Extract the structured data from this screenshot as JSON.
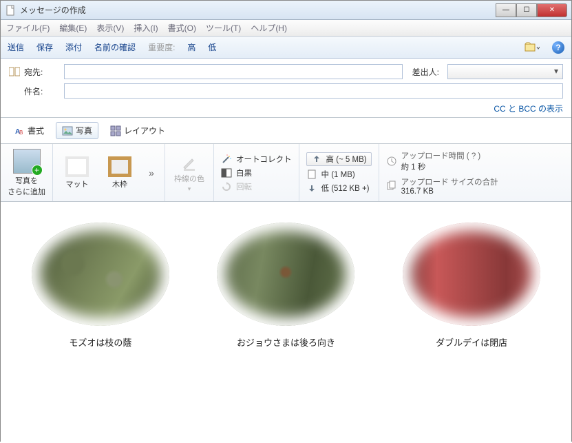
{
  "window": {
    "title": "メッセージの作成"
  },
  "menubar": {
    "file": "ファイル(F)",
    "edit": "編集(E)",
    "view": "表示(V)",
    "insert": "挿入(I)",
    "format": "書式(O)",
    "tools": "ツール(T)",
    "help": "ヘルプ(H)"
  },
  "toolbar": {
    "send": "送信",
    "save": "保存",
    "attach": "添付",
    "checknames": "名前の確認",
    "priority": "重要度:",
    "high": "高",
    "low": "低"
  },
  "address": {
    "to_label": "宛先:",
    "subject_label": "件名:",
    "sender_label": "差出人:",
    "ccbcc": "CC と BCC の表示",
    "to_value": "",
    "subject_value": ""
  },
  "viewtabs": {
    "format": "書式",
    "photo": "写真",
    "layout": "レイアウト"
  },
  "ribbon": {
    "add_photo": "写真を\nさらに追加",
    "matte": "マット",
    "wood": "木枠",
    "more": "»",
    "border_color": "枠線の色",
    "autocorrect": "オートコレクト",
    "bw": "白黒",
    "rotate": "回転",
    "size_high": "高 (~ 5 MB)",
    "size_med": "中 (1 MB)",
    "size_low": "低 (512 KB +)",
    "upload_time_label": "アップロード時間 ( ? )",
    "upload_time_value": "約 1 秒",
    "upload_size_label": "アップロード サイズの合計",
    "upload_size_value": "316.7 KB"
  },
  "photos": [
    {
      "caption": "モズオは枝の蔭"
    },
    {
      "caption": "おジョウさまは後ろ向き"
    },
    {
      "caption": "ダブルデイは閉店"
    }
  ]
}
